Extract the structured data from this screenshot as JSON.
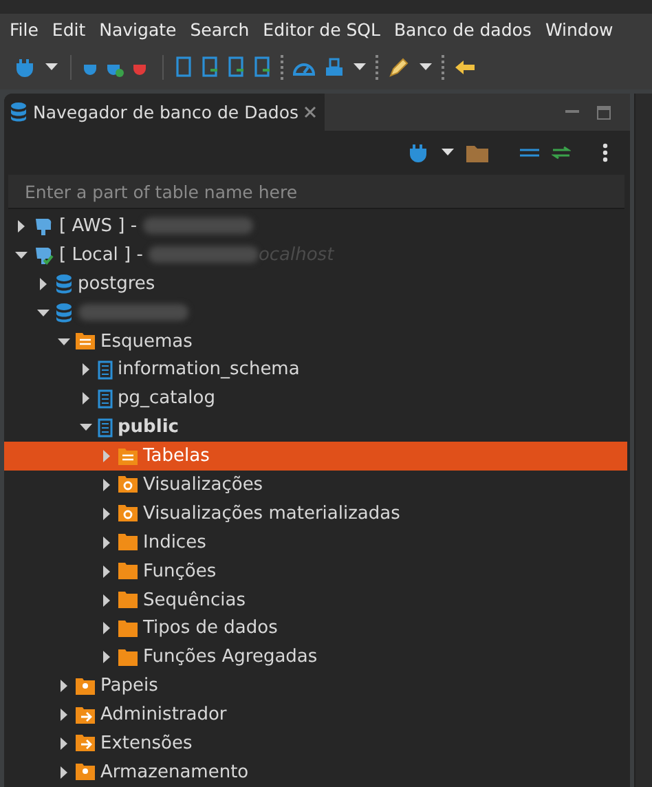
{
  "menu": [
    "File",
    "Edit",
    "Navigate",
    "Search",
    "Editor de SQL",
    "Banco de dados",
    "Window"
  ],
  "panel": {
    "title": "Navegador de banco de Dados",
    "selected": true
  },
  "search": {
    "placeholder": "Enter a part of table name here"
  },
  "tree": [
    {
      "kind": "connection",
      "label": "[ AWS ] -",
      "redacted": true,
      "connected": false,
      "expanded": false
    },
    {
      "kind": "connection",
      "label": "[ Local ] -",
      "redacted": true,
      "host": "ocalhost",
      "connected": true,
      "expanded": true,
      "children": [
        {
          "kind": "database",
          "label": "postgres",
          "expanded": false
        },
        {
          "kind": "database",
          "redacted": true,
          "expanded": true,
          "children": [
            {
              "kind": "schemas",
              "label": "Esquemas",
              "expanded": true,
              "children": [
                {
                  "kind": "schema",
                  "label": "information_schema",
                  "expanded": false
                },
                {
                  "kind": "schema",
                  "label": "pg_catalog",
                  "expanded": false
                },
                {
                  "kind": "schema",
                  "label": "public",
                  "bold": true,
                  "expanded": true,
                  "children": [
                    {
                      "kind": "tables",
                      "label": "Tabelas",
                      "expanded": false,
                      "selected": true
                    },
                    {
                      "kind": "views",
                      "label": "Visualizações",
                      "expanded": false,
                      "selected": false
                    },
                    {
                      "kind": "views",
                      "label": "Visualizações materializadas",
                      "expanded": false,
                      "selected": false
                    },
                    {
                      "kind": "folder",
                      "label": "Indices",
                      "expanded": false,
                      "selected": false
                    },
                    {
                      "kind": "folder",
                      "label": "Funções",
                      "expanded": false,
                      "selected": false
                    },
                    {
                      "kind": "folder",
                      "label": "Sequências",
                      "expanded": false,
                      "selected": false
                    },
                    {
                      "kind": "folder",
                      "label": "Tipos de dados",
                      "expanded": false,
                      "selected": false
                    },
                    {
                      "kind": "folder",
                      "label": "Funções Agregadas",
                      "expanded": false,
                      "selected": false
                    }
                  ]
                }
              ]
            },
            {
              "kind": "roles",
              "label": "Papeis",
              "expanded": false
            },
            {
              "kind": "admin",
              "label": "Administrador",
              "expanded": false
            },
            {
              "kind": "admin",
              "label": "Extensões",
              "expanded": false
            },
            {
              "kind": "roles",
              "label": "Armazenamento",
              "expanded": false
            }
          ]
        }
      ]
    }
  ]
}
